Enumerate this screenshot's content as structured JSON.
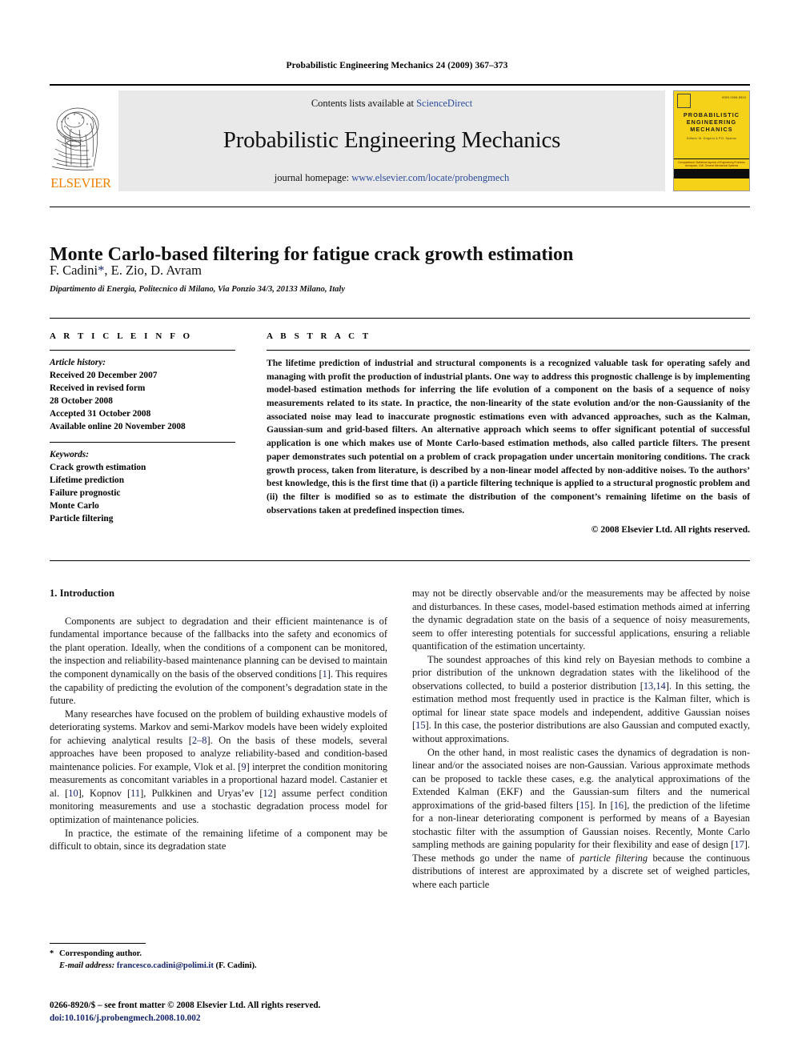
{
  "running_head": "Probabilistic Engineering Mechanics 24 (2009) 367–373",
  "banner": {
    "publisher_logo_text": "ELSEVIER",
    "contents_prefix": "Contents lists available at ",
    "contents_link": "ScienceDirect",
    "journal_title": "Probabilistic Engineering Mechanics",
    "homepage_prefix": "journal homepage: ",
    "homepage_url": "www.elsevier.com/locate/probengmech",
    "cover": {
      "issn": "ISSN 0266-8920",
      "title_line1": "PROBABILISTIC",
      "title_line2": "ENGINEERING",
      "title_line3": "MECHANICS",
      "editors": "Editors: M. Grigoriu & P.D. Spanos",
      "strip_line1": "Computational, Statistical Aspects of Engineering Problems",
      "strip_line2": "Aerospace, Civil, General Mechanical Systems"
    }
  },
  "article": {
    "title": "Monte Carlo-based filtering for fatigue crack growth estimation",
    "authors": "F. Cadini",
    "authors_tail": ", E. Zio, D. Avram",
    "corresponding_marker": "*",
    "affiliation": "Dipartimento di Energia, Politecnico di Milano, Via Ponzio 34/3, 20133 Milano, Italy"
  },
  "article_info": {
    "heading": "A R T I C L E   I N F O",
    "history_label": "Article history:",
    "history": [
      "Received 20 December 2007",
      "Received in revised form",
      "28 October 2008",
      "Accepted 31 October 2008",
      "Available online 20 November 2008"
    ],
    "keywords_label": "Keywords:",
    "keywords": [
      "Crack growth estimation",
      "Lifetime prediction",
      "Failure prognostic",
      "Monte Carlo",
      "Particle filtering"
    ]
  },
  "abstract": {
    "heading": "A B S T R A C T",
    "text": "The lifetime prediction of industrial and structural components is a recognized valuable task for operating safely and managing with profit the production of industrial plants. One way to address this prognostic challenge is by implementing model-based estimation methods for inferring the life evolution of a component on the basis of a sequence of noisy measurements related to its state. In practice, the non-linearity of the state evolution and/or the non-Gaussianity of the associated noise may lead to inaccurate prognostic estimations even with advanced approaches, such as the Kalman, Gaussian-sum and grid-based filters. An alternative approach which seems to offer significant potential of successful application is one which makes use of Monte Carlo-based estimation methods, also called particle filters. The present paper demonstrates such potential on a problem of crack propagation under uncertain monitoring conditions. The crack growth process, taken from literature, is described by a non-linear model affected by non-additive noises. To the authors’ best knowledge, this is the first time that (i) a particle filtering technique is applied to a structural prognostic problem and (ii) the filter is modified so as to estimate the distribution of the component’s remaining lifetime on the basis of observations taken at predefined inspection times.",
    "copyright": "© 2008 Elsevier Ltd. All rights reserved."
  },
  "body": {
    "section_number_title": "1. Introduction",
    "left_paragraphs": [
      {
        "parts": [
          {
            "t": "Components are subject to degradation and their efficient maintenance is of fundamental importance because of the fallbacks into the safety and economics of the plant operation. Ideally, when the conditions of a component can be monitored, the inspection and reliability-based maintenance planning can be devised to maintain the component dynamically on the basis of the observed conditions ["
          },
          {
            "t": "1",
            "style": "ref"
          },
          {
            "t": "]. This requires the capability of predicting the evolution of the component’s degradation state in the future."
          }
        ]
      },
      {
        "parts": [
          {
            "t": "Many researches have focused on the problem of building exhaustive models of deteriorating systems. Markov and semi-Markov models have been widely exploited for achieving analytical results ["
          },
          {
            "t": "2–8",
            "style": "ref"
          },
          {
            "t": "]. On the basis of these models, several approaches have been proposed to analyze reliability-based and condition-based maintenance policies. For example, Vlok et al. ["
          },
          {
            "t": "9",
            "style": "ref"
          },
          {
            "t": "] interpret the condition monitoring measurements as concomitant variables in a proportional hazard model. Castanier et al. ["
          },
          {
            "t": "10",
            "style": "ref"
          },
          {
            "t": "], Kopnov ["
          },
          {
            "t": "11",
            "style": "ref"
          },
          {
            "t": "], Pulkkinen and Uryas’ev ["
          },
          {
            "t": "12",
            "style": "ref"
          },
          {
            "t": "] assume perfect condition monitoring measurements and use a stochastic degradation process model for optimization of maintenance policies."
          }
        ]
      },
      {
        "parts": [
          {
            "t": "In practice, the estimate of the remaining lifetime of a component may be difficult to obtain, since its degradation state"
          }
        ]
      }
    ],
    "right_paragraphs": [
      {
        "continued": true,
        "parts": [
          {
            "t": "may not be directly observable and/or the measurements may be affected by noise and disturbances. In these cases, model-based estimation methods aimed at inferring the dynamic degradation state on the basis of a sequence of noisy measurements, seem to offer interesting potentials for successful applications, ensuring a reliable quantification of the estimation uncertainty."
          }
        ]
      },
      {
        "parts": [
          {
            "t": "The soundest approaches of this kind rely on Bayesian methods to combine a prior distribution of the unknown degradation states with the likelihood of the observations collected, to build a posterior distribution ["
          },
          {
            "t": "13,14",
            "style": "ref"
          },
          {
            "t": "]. In this setting, the estimation method most frequently used in practice is the Kalman filter, which is optimal for linear state space models and independent, additive Gaussian noises ["
          },
          {
            "t": "15",
            "style": "ref"
          },
          {
            "t": "]. In this case, the posterior distributions are also Gaussian and computed exactly, without approximations."
          }
        ]
      },
      {
        "parts": [
          {
            "t": "On the other hand, in most realistic cases the dynamics of degradation is non-linear and/or the associated noises are non-Gaussian. Various approximate methods can be proposed to tackle these cases, e.g. the analytical approximations of the Extended Kalman (EKF) and the Gaussian-sum filters and the numerical approximations of the grid-based filters ["
          },
          {
            "t": "15",
            "style": "ref"
          },
          {
            "t": "]. In ["
          },
          {
            "t": "16",
            "style": "ref"
          },
          {
            "t": "], the prediction of the lifetime for a non-linear deteriorating component is performed by means of a Bayesian stochastic filter with the assumption of Gaussian noises. Recently, Monte Carlo sampling methods are gaining popularity for their flexibility and ease of design ["
          },
          {
            "t": "17",
            "style": "ref"
          },
          {
            "t": "]. These methods go under the name of "
          },
          {
            "t": "particle filtering",
            "style": "ital"
          },
          {
            "t": " because the continuous distributions of interest are approximated by a discrete set of weighed particles, where each particle"
          }
        ]
      }
    ]
  },
  "footnote": {
    "corresponding_star": "*",
    "corresponding_text": "Corresponding author.",
    "email_label": "E-mail address:",
    "email": "francesco.cadini@polimi.it",
    "email_owner": "(F. Cadini)."
  },
  "imprint": {
    "line1": "0266-8920/$ – see front matter © 2008 Elsevier Ltd. All rights reserved.",
    "doi": "doi:10.1016/j.probengmech.2008.10.002"
  },
  "colors": {
    "link": "#2b4c9b",
    "reference": "#16256b",
    "elsevier_orange": "#f08000",
    "cover_yellow": "#f5d117",
    "banner_grey": "#e9e9e9"
  }
}
